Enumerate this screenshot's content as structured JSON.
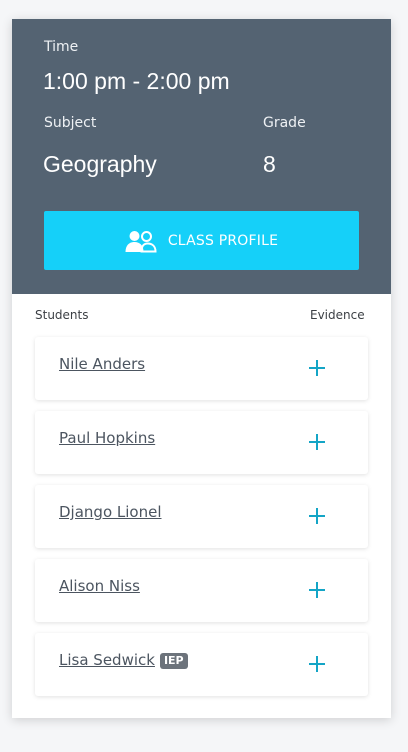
{
  "header": {
    "time_label": "Time",
    "time_value": "1:00 pm - 2:00 pm",
    "subject_label": "Subject",
    "subject_value": "Geography",
    "grade_label": "Grade",
    "grade_value": "8",
    "class_profile_label": "CLASS PROFILE"
  },
  "columns": {
    "students": "Students",
    "evidence": "Evidence"
  },
  "students": [
    {
      "name": "Nile Anders",
      "badge": ""
    },
    {
      "name": "Paul Hopkins",
      "badge": ""
    },
    {
      "name": "Django Lionel",
      "badge": ""
    },
    {
      "name": "Alison Niss",
      "badge": ""
    },
    {
      "name": "Lisa Sedwick",
      "badge": "IEP"
    }
  ],
  "colors": {
    "header_bg": "#546372",
    "button_bg": "#15d0f9",
    "plus_icon": "#14a5c6"
  }
}
